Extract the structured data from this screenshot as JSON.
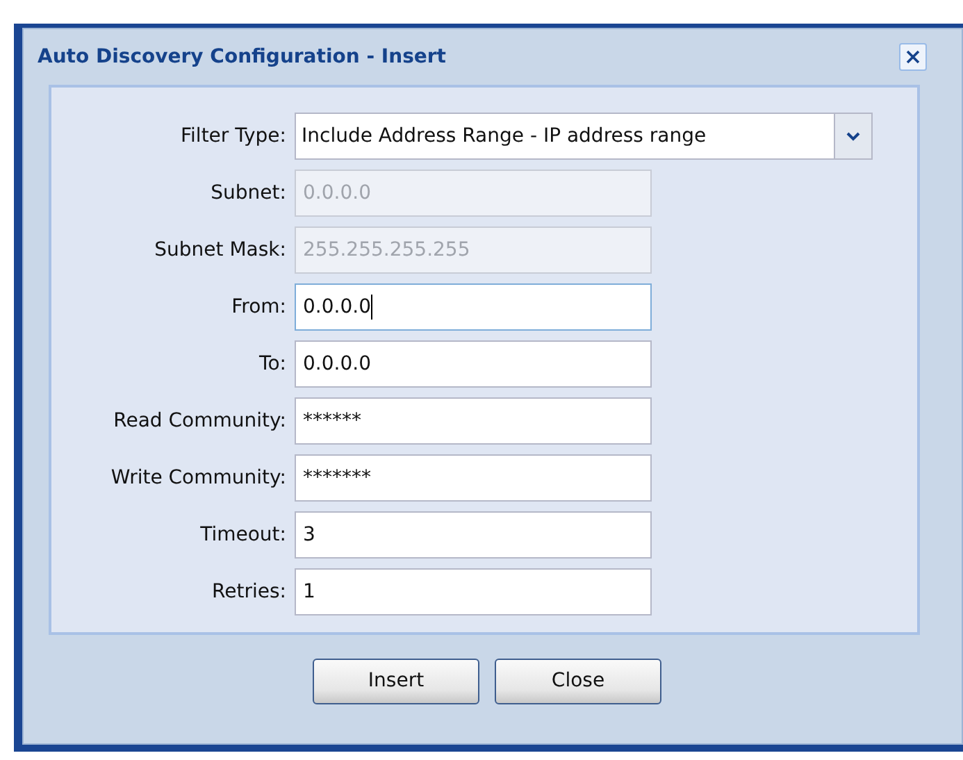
{
  "dialog": {
    "title": "Auto Discovery Configuration - Insert"
  },
  "fields": [
    {
      "label": "Filter Type:",
      "kind": "dropdown",
      "value": "Include Address Range - IP address range"
    },
    {
      "label": "Subnet:",
      "kind": "text",
      "value": "0.0.0.0",
      "disabled": true,
      "focused": false
    },
    {
      "label": "Subnet Mask:",
      "kind": "text",
      "value": "255.255.255.255",
      "disabled": true,
      "focused": false
    },
    {
      "label": "From:",
      "kind": "text",
      "value": "0.0.0.0",
      "disabled": false,
      "focused": true
    },
    {
      "label": "To:",
      "kind": "text",
      "value": "0.0.0.0",
      "disabled": false,
      "focused": false
    },
    {
      "label": "Read Community:",
      "kind": "text",
      "value": "******",
      "disabled": false,
      "focused": false
    },
    {
      "label": "Write Community:",
      "kind": "text",
      "value": "*******",
      "disabled": false,
      "focused": false
    },
    {
      "label": "Timeout:",
      "kind": "text",
      "value": "3",
      "disabled": false,
      "focused": false
    },
    {
      "label": "Retries:",
      "kind": "text",
      "value": "1",
      "disabled": false,
      "focused": false
    }
  ],
  "buttons": [
    "Insert",
    "Close"
  ]
}
